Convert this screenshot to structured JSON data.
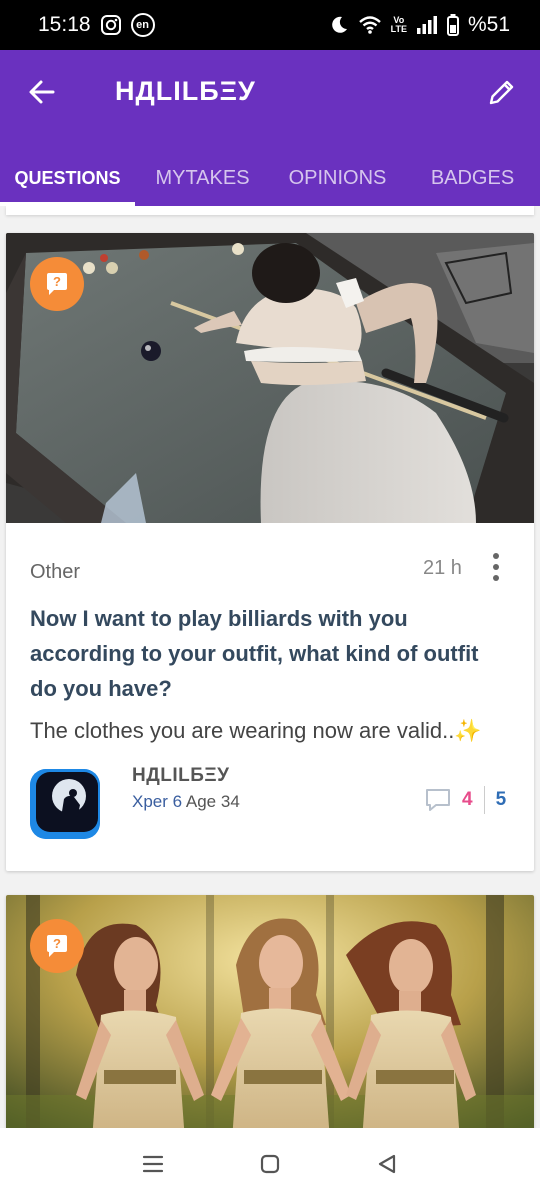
{
  "status_bar": {
    "time": "15:18",
    "battery": "%51",
    "lte_top": "Vo",
    "lte_bottom": "LTE",
    "lang_badge": "en"
  },
  "header": {
    "title": "НДLILБΞУ",
    "color": "#6a31bf"
  },
  "tabs": [
    {
      "label": "QUESTIONS",
      "active": true
    },
    {
      "label": "MYTAKES",
      "active": false
    },
    {
      "label": "OPINIONS",
      "active": false
    },
    {
      "label": "BADGES",
      "active": false
    }
  ],
  "posts": [
    {
      "category": "Other",
      "time": "21 h",
      "title": "Now I want to play billiards with you according to your outfit, what kind of outfit do you have?",
      "description": "The clothes you are wearing now are valid..✨",
      "author": {
        "name": "НДLILБΞУ",
        "level": "Xper 6",
        "age": "Age 34"
      },
      "opinions": "4",
      "questions": "5",
      "badge_icon": "question-bubble-icon"
    },
    {
      "badge_icon": "question-bubble-icon"
    }
  ],
  "colors": {
    "accent": "#6a31bf",
    "badge_orange": "#f58c38",
    "opinion_pink": "#e74c8b",
    "count_blue": "#2f6db5"
  }
}
